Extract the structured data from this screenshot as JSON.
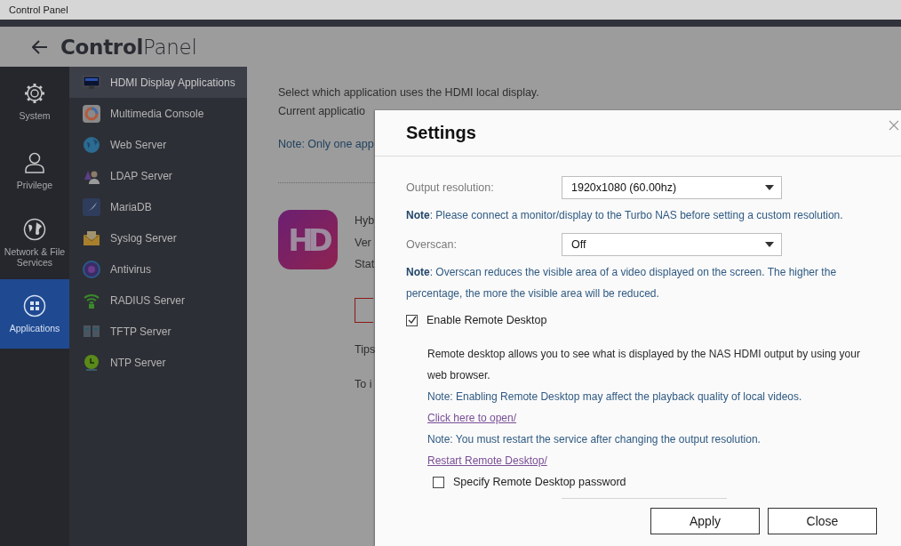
{
  "window": {
    "title": "Control Panel"
  },
  "header": {
    "title": "**Control**Panel"
  },
  "nav": [
    {
      "label": "System",
      "kind": "gear",
      "selected": false
    },
    {
      "label": "Privilege",
      "kind": "person",
      "selected": false
    },
    {
      "label": "Network & File Services",
      "kind": "globe",
      "selected": false
    },
    {
      "label": "Applications",
      "kind": "grid",
      "selected": true
    }
  ],
  "apps": [
    {
      "label": "HDMI Display Applications",
      "kind": "monitor",
      "selected": true
    },
    {
      "label": "Multimedia Console",
      "kind": "ring",
      "selected": false
    },
    {
      "label": "Web Server",
      "kind": "globe",
      "selected": false
    },
    {
      "label": "LDAP Server",
      "kind": "user",
      "selected": false
    },
    {
      "label": "MariaDB",
      "kind": "database",
      "selected": false
    },
    {
      "label": "Syslog Server",
      "kind": "envelope",
      "selected": false
    },
    {
      "label": "Antivirus",
      "kind": "shield",
      "selected": false
    },
    {
      "label": "RADIUS Server",
      "kind": "wifi",
      "selected": false
    },
    {
      "label": "TFTP Server",
      "kind": "server",
      "selected": false
    },
    {
      "label": "NTP Server",
      "kind": "clock",
      "selected": false
    }
  ],
  "content": {
    "intro": "Select which application uses the HDMI local display.",
    "current": "Current applicatio",
    "note": "Note: Only one app",
    "app_logo": "HD",
    "app_info": [
      "Hyb",
      "Ver",
      "Stat"
    ],
    "tips": "Tips",
    "hint": "To i"
  },
  "dialog": {
    "title": "Settings",
    "fields": [
      {
        "label": "Output resolution:",
        "value": "1920x1080 (60.00hz)",
        "note": "**Note**: Please connect a monitor/display to the Turbo NAS before setting a custom resolution."
      },
      {
        "label": "Overscan:",
        "value": "Off",
        "note": "**Note**: Overscan reduces the visible area of a video displayed on the screen. The higher the percentage, the more the visible area will be reduced."
      }
    ],
    "remote": {
      "label": "Enable Remote Desktop",
      "checked": true,
      "lines": [
        {
          "kind": "text",
          "text": "Remote desktop allows you to see what is displayed by the NAS HDMI output by using your web browser."
        },
        {
          "kind": "note",
          "text": "Note: Enabling Remote Desktop may affect the playback quality of local videos."
        },
        {
          "kind": "link",
          "text": "Click here to open/"
        },
        {
          "kind": "note",
          "text": "Note: You must restart the service after changing the output resolution."
        },
        {
          "kind": "link",
          "text": "Restart Remote Desktop/"
        }
      ],
      "password": {
        "label": "Specify Remote Desktop password",
        "checked": false
      }
    },
    "buttons": [
      "Apply",
      "Close"
    ]
  }
}
